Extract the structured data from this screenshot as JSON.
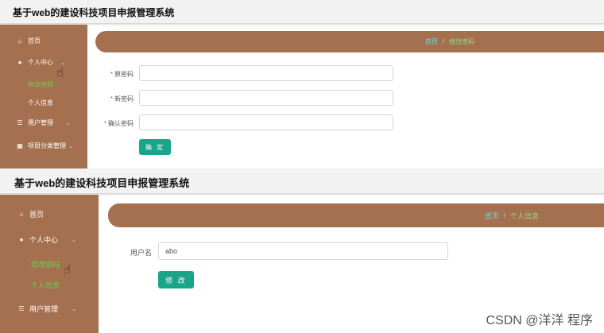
{
  "app_title": "基于web的建设科技项目申报管理系统",
  "panel1": {
    "sidebar": {
      "home": "首页",
      "personal_center": "个人中心",
      "change_password": "修改密码",
      "personal_info": "个人信息",
      "user_management": "用户管理",
      "category_management": "项目分类管理"
    },
    "breadcrumb": {
      "home": "首页",
      "separator": "/",
      "current": "修改密码"
    },
    "form": {
      "required_mark": "*",
      "old_password_label": "原密码",
      "new_password_label": "新密码",
      "confirm_password_label": "确认密码",
      "old_password_value": "",
      "new_password_value": "",
      "confirm_password_value": "",
      "submit_label": "确 定"
    }
  },
  "panel2": {
    "sidebar": {
      "home": "首页",
      "personal_center": "个人中心",
      "change_password": "修改密码",
      "personal_info": "个人信息",
      "user_management": "用户管理"
    },
    "breadcrumb": {
      "home": "首页",
      "separator": "/",
      "current": "个人信息"
    },
    "form": {
      "username_label": "用户名",
      "username_value": "abo",
      "submit_label": "修 改"
    }
  },
  "watermark": "CSDN @洋洋  程序",
  "colors": {
    "sidebar_bg": "#a47050",
    "active_menu": "#6bd04a",
    "crumb_link": "#6fd6e0",
    "crumb_current": "#8fe07a",
    "button": "#1aa58b",
    "required": "#e04848"
  },
  "icons": {
    "home": "home-icon",
    "user": "user-icon",
    "menu": "menu-icon",
    "grid": "grid-icon",
    "chevron": "chevron-down-icon",
    "cursor": "hand-cursor-icon"
  }
}
